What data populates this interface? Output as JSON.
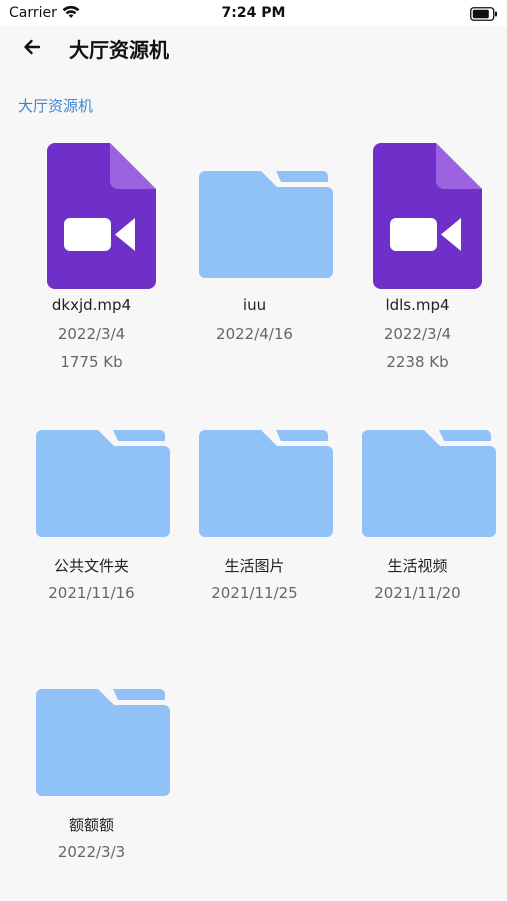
{
  "status_bar": {
    "carrier": "Carrier",
    "time": "7:24 PM",
    "wifi_icon": "wifi-icon",
    "battery_icon": "battery-icon"
  },
  "nav": {
    "back_icon": "back-arrow-icon",
    "title": "大厅资源机"
  },
  "breadcrumb": "大厅资源机",
  "colors": {
    "folder": "#90c2f8",
    "video_file": "#6e30c9",
    "video_fold": "#9b63e0",
    "breadcrumb": "#3d86d0"
  },
  "items": [
    {
      "type": "video",
      "icon": "video-file-icon",
      "name": "dkxjd.mp4",
      "date": "2022/3/4",
      "size": "1775 Kb"
    },
    {
      "type": "folder",
      "icon": "folder-icon",
      "name": "iuu",
      "date": "2022/4/16",
      "size": ""
    },
    {
      "type": "video",
      "icon": "video-file-icon",
      "name": "ldls.mp4",
      "date": "2022/3/4",
      "size": "2238 Kb"
    },
    {
      "type": "folder",
      "icon": "folder-icon",
      "name": "公共文件夹",
      "date": "2021/11/16",
      "size": ""
    },
    {
      "type": "folder",
      "icon": "folder-icon",
      "name": "生活图片",
      "date": "2021/11/25",
      "size": ""
    },
    {
      "type": "folder",
      "icon": "folder-icon",
      "name": "生活视频",
      "date": "2021/11/20",
      "size": ""
    },
    {
      "type": "folder",
      "icon": "folder-icon",
      "name": "额额额",
      "date": "2022/3/3",
      "size": ""
    }
  ]
}
